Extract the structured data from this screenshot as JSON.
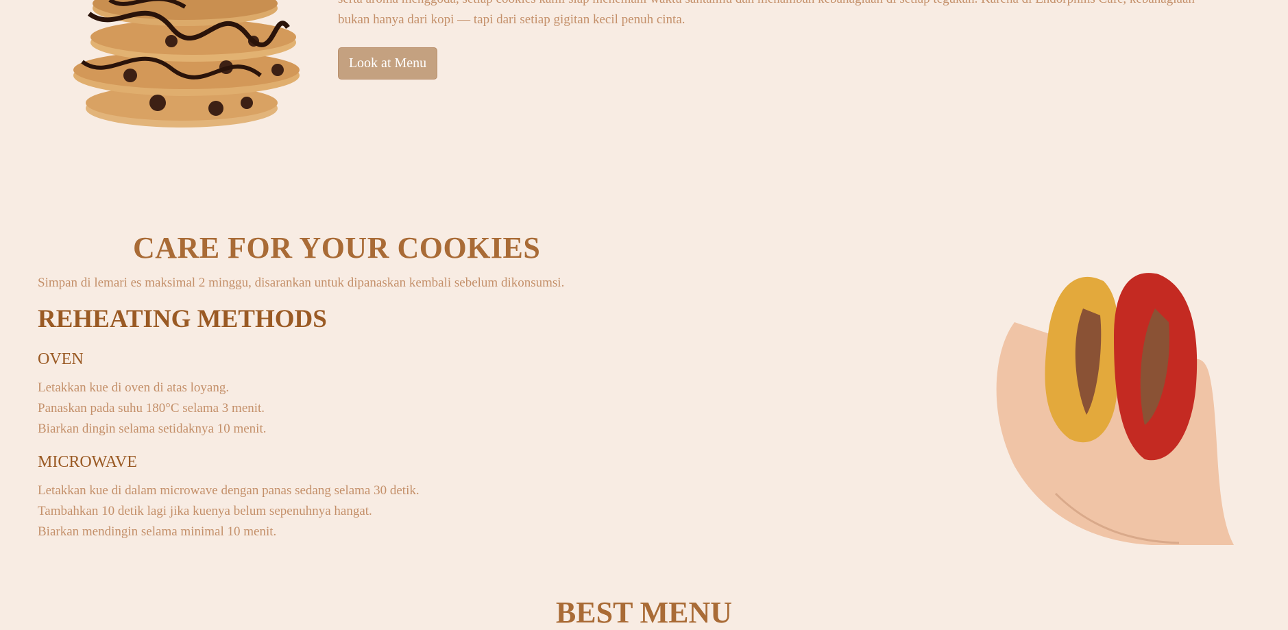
{
  "intro": {
    "line1": "serta aroma menggoda, setiap cookies kami siap menemani waktu santaimu dan menambah kebahagiaan di setiap tegukan. Karena di Endorphins Cafe, kebahagiaan",
    "line2": "bukan hanya dari kopi — tapi dari setiap gigitan kecil penuh cinta.",
    "button_label": "Look at Menu"
  },
  "care": {
    "title": "CARE FOR YOUR COOKIES",
    "text": "Simpan di lemari es maksimal 2 minggu, disarankan untuk dipanaskan kembali sebelum dikonsumsi.",
    "reheat_title": "REHEATING METHODS",
    "methods": [
      {
        "title": "OVEN",
        "steps": [
          "Letakkan kue di oven di atas loyang.",
          "Panaskan pada suhu 180°C selama 3 menit.",
          "Biarkan dingin selama setidaknya 10 menit."
        ]
      },
      {
        "title": "MICROWAVE",
        "steps": [
          "Letakkan kue di dalam microwave dengan panas sedang selama 30 detik.",
          "Tambahkan 10 detik lagi jika kuenya belum sepenuhnya hangat.",
          "Biarkan mendingin selama minimal 10 menit."
        ]
      }
    ]
  },
  "best_menu": {
    "title": "BEST MENU"
  },
  "colors": {
    "background": "#f8ece3",
    "heading": "#a96b36",
    "body_text": "#c4906a",
    "button": "#c4a180"
  }
}
